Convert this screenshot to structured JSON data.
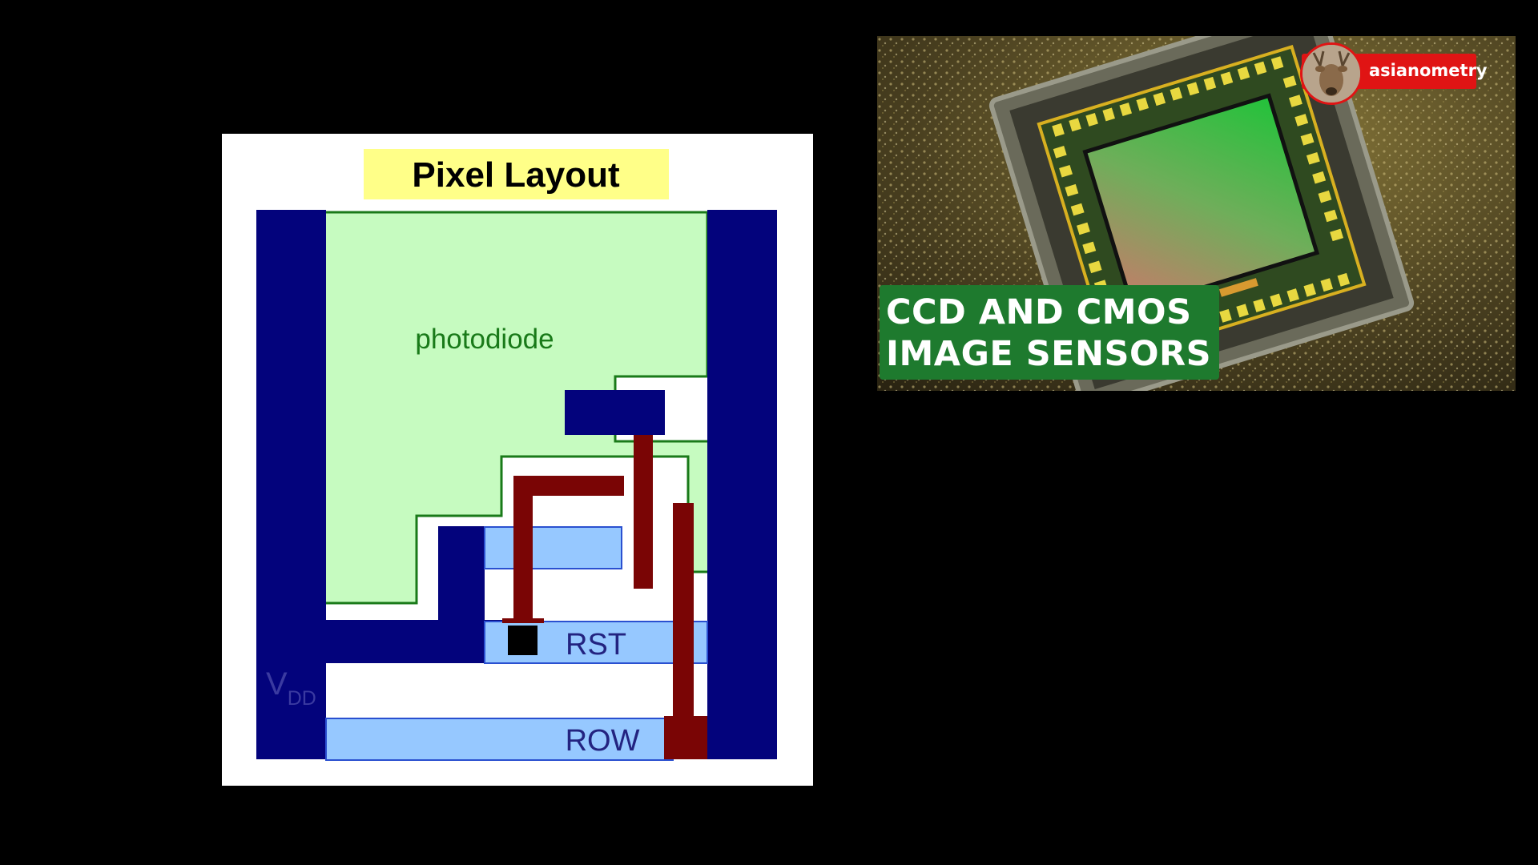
{
  "diagram": {
    "title": "Pixel Layout",
    "labels": {
      "photodiode": "photodiode",
      "rst": "RST",
      "row": "ROW",
      "vdd_main": "V",
      "vdd_sub": "DD"
    },
    "colors": {
      "title_bg": "#ffff88",
      "photodiode_fill": "#c6fbc0",
      "photodiode_outline": "#197a19",
      "metal_navy": "#03037c",
      "poly_light_blue": "#96c8ff",
      "poly_dark_red": "#7a0505",
      "contact_black": "#000000",
      "label_green": "#197a19",
      "label_navy": "#232380"
    }
  },
  "thumbnail": {
    "caption_line1": "CCD AND CMOS",
    "caption_line2": "IMAGE SENSORS",
    "channel": "asianometry",
    "colors": {
      "caption_bg": "#1e7a2e",
      "badge_bg": "#e01414"
    }
  }
}
